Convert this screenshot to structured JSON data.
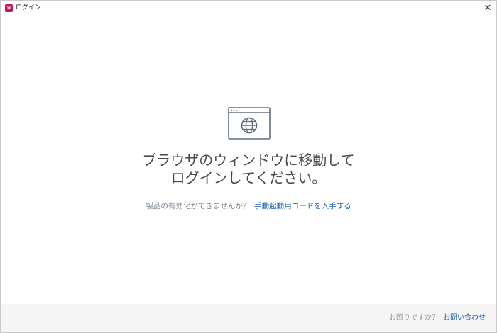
{
  "window": {
    "title": "ログイン",
    "app_icon_glyph": "✲",
    "close_glyph": "✕"
  },
  "main": {
    "icon": "browser-globe-icon",
    "heading_line1": "ブラウザのウィンドウに移動して",
    "heading_line2": "ログインしてください。",
    "activation_question": "製品の有効化ができませんか？",
    "activation_link": "手動起動用コードを入手する"
  },
  "footer": {
    "help_question": "お困りですか？",
    "help_link": "お問い合わせ"
  },
  "colors": {
    "accent_link": "#1f5fb5",
    "heading": "#4a4a4a",
    "app_icon": "#c2185b",
    "icon_stroke": "#5f6f7f"
  }
}
